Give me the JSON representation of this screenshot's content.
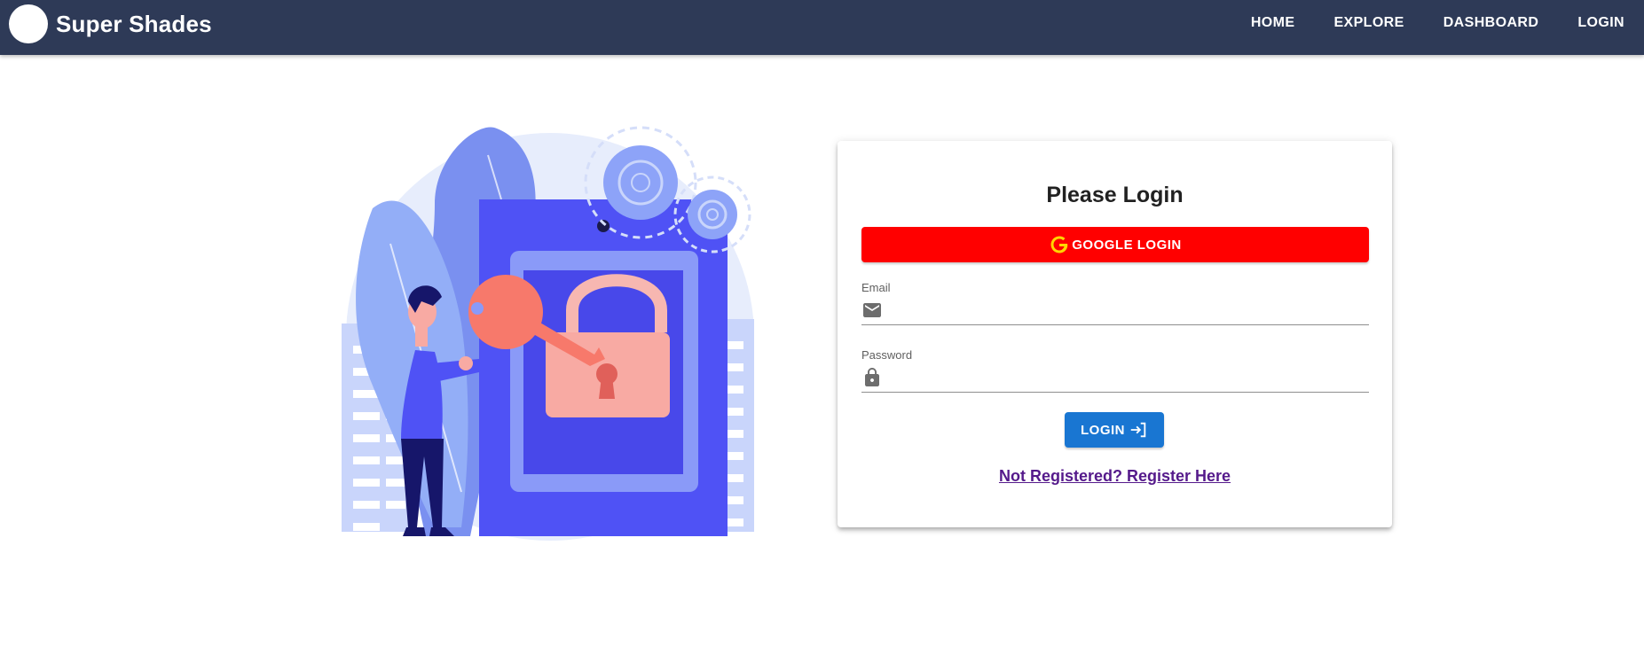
{
  "app": {
    "brand": "Super Shades"
  },
  "nav": {
    "items": [
      {
        "label": "HOME"
      },
      {
        "label": "EXPLORE"
      },
      {
        "label": "DASHBOARD"
      },
      {
        "label": "LOGIN"
      }
    ]
  },
  "login": {
    "title": "Please Login",
    "google_label": "GOOGLE LOGIN",
    "email_label": "Email",
    "email_value": "",
    "password_label": "Password",
    "password_value": "",
    "submit_label": "LOGIN",
    "register_text": "Not Registered? Register Here"
  },
  "icons": {
    "google": "google-icon",
    "email": "mail-icon",
    "password": "lock-icon",
    "submit": "login-arrow-icon"
  },
  "colors": {
    "appbar": "#2e3a57",
    "google_button": "#ff0000",
    "login_button": "#1976d2",
    "link": "#551a8b",
    "illustration_primary": "#4f52f5",
    "illustration_accent": "#f7796b"
  }
}
